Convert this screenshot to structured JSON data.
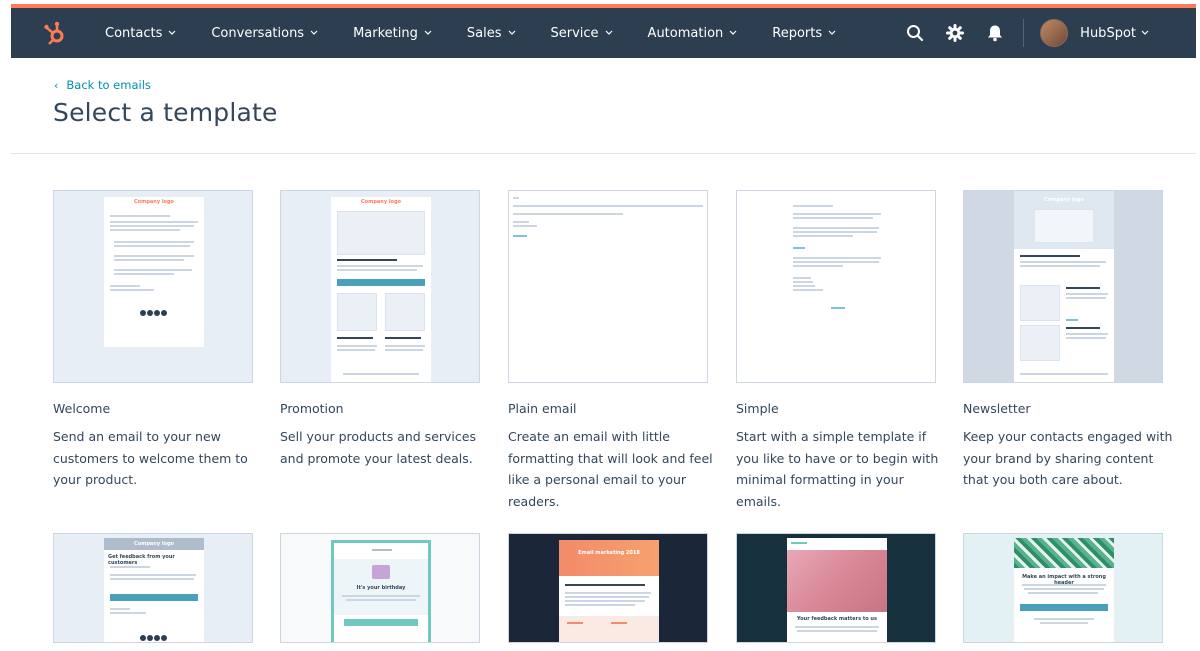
{
  "nav": {
    "menu": [
      {
        "label": "Contacts"
      },
      {
        "label": "Conversations"
      },
      {
        "label": "Marketing"
      },
      {
        "label": "Sales"
      },
      {
        "label": "Service"
      },
      {
        "label": "Automation"
      },
      {
        "label": "Reports"
      }
    ],
    "account_label": "HubSpot",
    "icons": [
      "hubspot-logo-icon",
      "search-icon",
      "gear-icon",
      "bell-icon",
      "avatar"
    ],
    "accent_color": "#ff7a59",
    "bar_color": "#2d3e50"
  },
  "page": {
    "back_link": "Back to emails",
    "title": "Select a template"
  },
  "templates": [
    {
      "name": "Welcome",
      "description": "Send an email to your new customers to welcome them to your product."
    },
    {
      "name": "Promotion",
      "description": "Sell your products and services and promote your latest deals."
    },
    {
      "name": "Plain email",
      "description": "Create an email with little formatting that will look and feel like a personal email to your readers."
    },
    {
      "name": "Simple",
      "description": "Start with a simple template if you like to have or to begin with minimal formatting in your emails."
    },
    {
      "name": "Newsletter",
      "description": "Keep your contacts engaged with your brand by sharing content that you both care about."
    }
  ],
  "thumb_text": {
    "company_logo": "Company logo",
    "feedback_heading": "Get feedback from your customers",
    "birthday": "It's your birthday",
    "email_marketing": "Email marketing 2018",
    "feedback_matters": "Your feedback matters to us",
    "impact": "Make an impact with a strong header"
  }
}
